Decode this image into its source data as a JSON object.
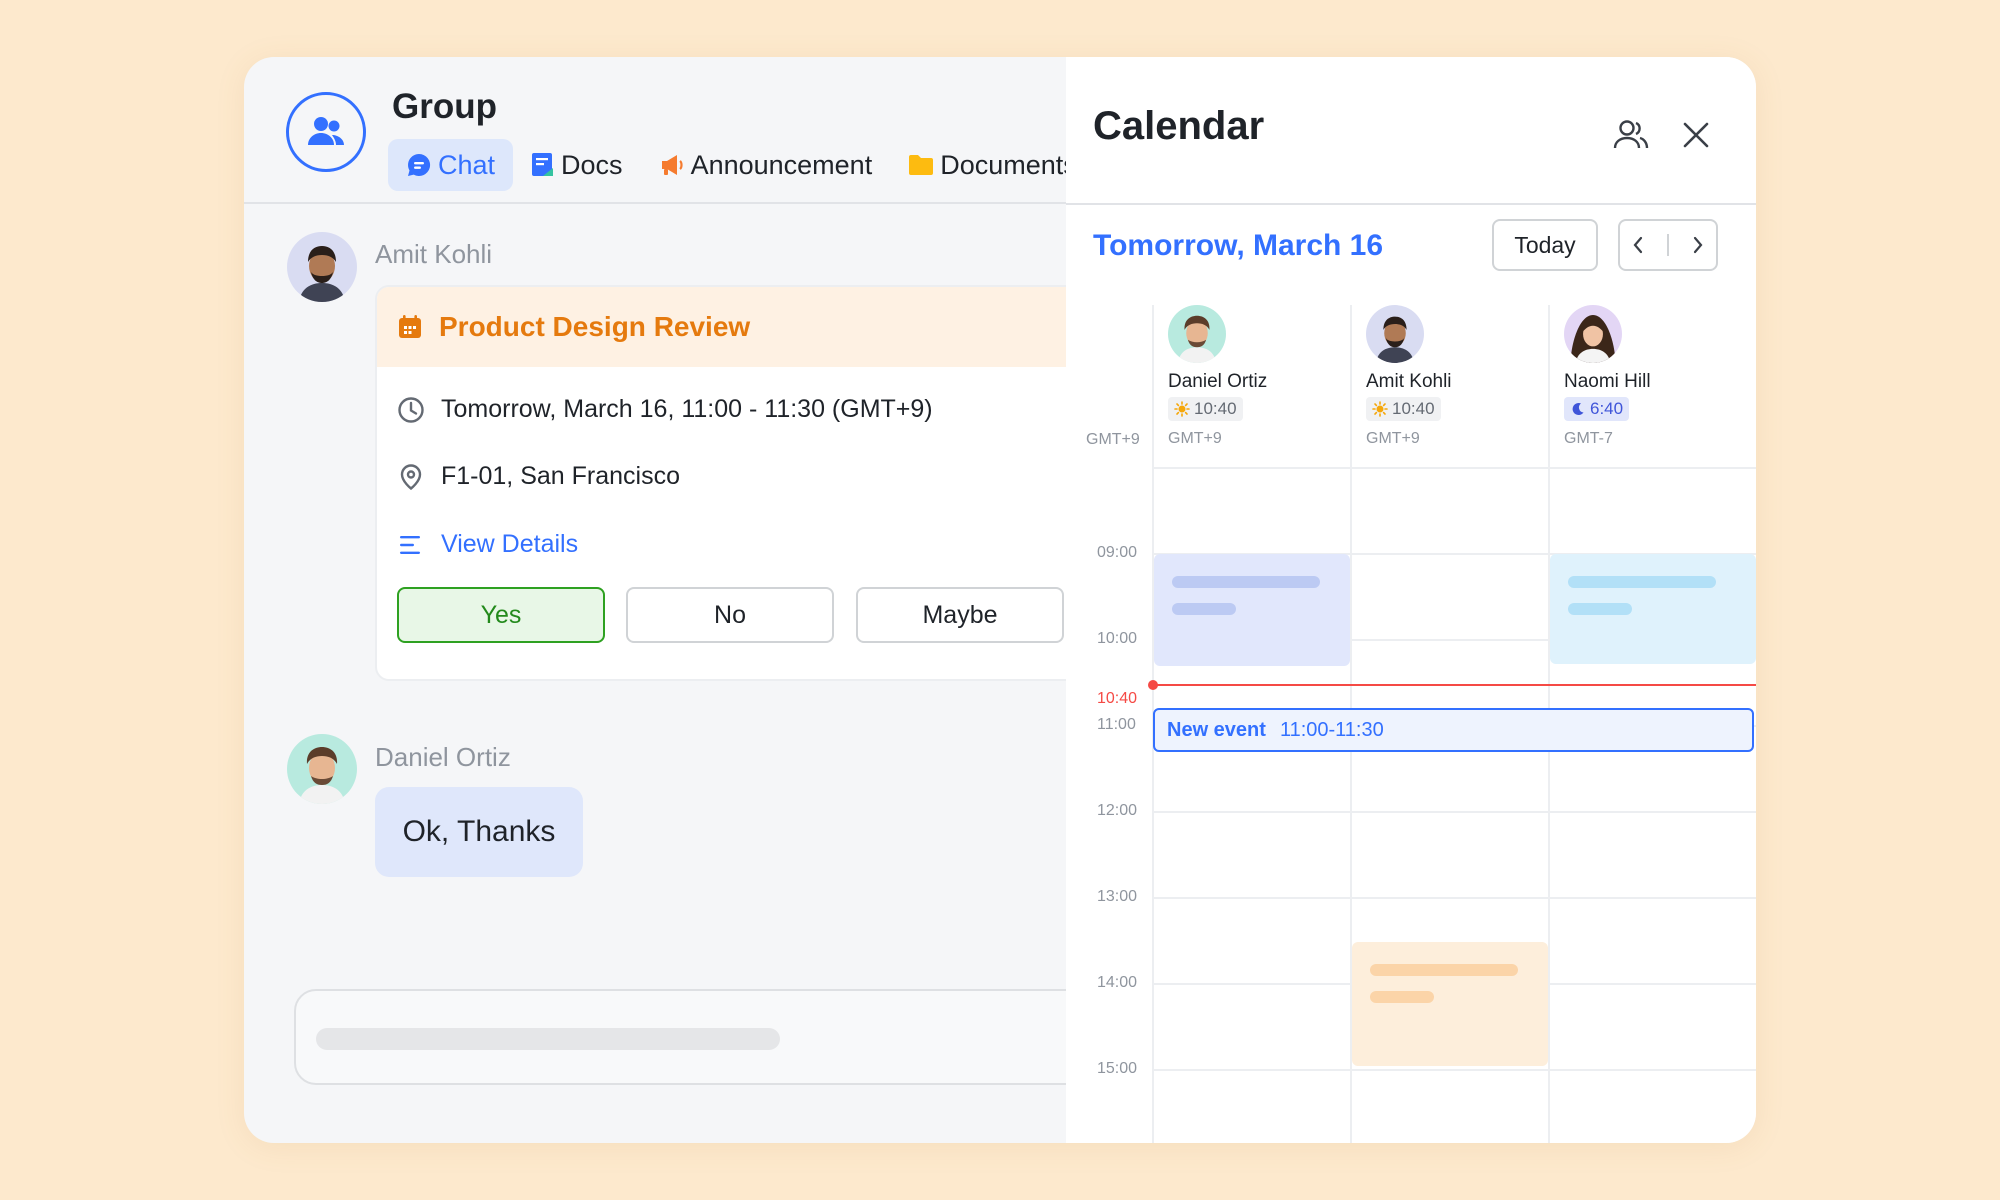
{
  "group": {
    "title": "Group",
    "tabs": [
      {
        "label": "Chat",
        "icon": "chat-icon",
        "active": true
      },
      {
        "label": "Docs",
        "icon": "docs-icon"
      },
      {
        "label": "Announcement",
        "icon": "megaphone-icon"
      },
      {
        "label": "Documents",
        "icon": "folder-icon"
      }
    ]
  },
  "messages": [
    {
      "sender": "Amit Kohli",
      "type": "event_card"
    },
    {
      "sender": "Daniel Ortiz",
      "text": "Ok, Thanks"
    }
  ],
  "event_card": {
    "title": "Product Design Review",
    "time": "Tomorrow, March 16, 11:00 - 11:30 (GMT+9)",
    "location": "F1-01, San Francisco",
    "details_link": "View Details",
    "rsvp": {
      "yes": "Yes",
      "no": "No",
      "maybe": "Maybe",
      "selected": "yes"
    }
  },
  "calendar": {
    "title": "Calendar",
    "date_label": "Tomorrow, March 16",
    "today_button": "Today",
    "timezone": "GMT+9",
    "people": [
      {
        "name": "Daniel Ortiz",
        "local_time": "10:40",
        "time_icon": "sun-icon",
        "tz": "GMT+9"
      },
      {
        "name": "Amit Kohli",
        "local_time": "10:40",
        "time_icon": "sun-icon",
        "tz": "GMT+9"
      },
      {
        "name": "Naomi Hill",
        "local_time": "6:40",
        "time_icon": "moon-icon",
        "tz": "GMT-7"
      }
    ],
    "hours": [
      "09:00",
      "10:00",
      "11:00",
      "12:00",
      "13:00",
      "14:00",
      "15:00"
    ],
    "current_time": "10:40",
    "new_event": {
      "label": "New event",
      "time": "11:00-11:30"
    },
    "colors": {
      "accent": "#3370ff",
      "now_line": "#f54a45",
      "busy_blue": "#e1e7fc",
      "busy_cyan": "#dff2fc",
      "busy_orange": "#fdeedb"
    }
  }
}
